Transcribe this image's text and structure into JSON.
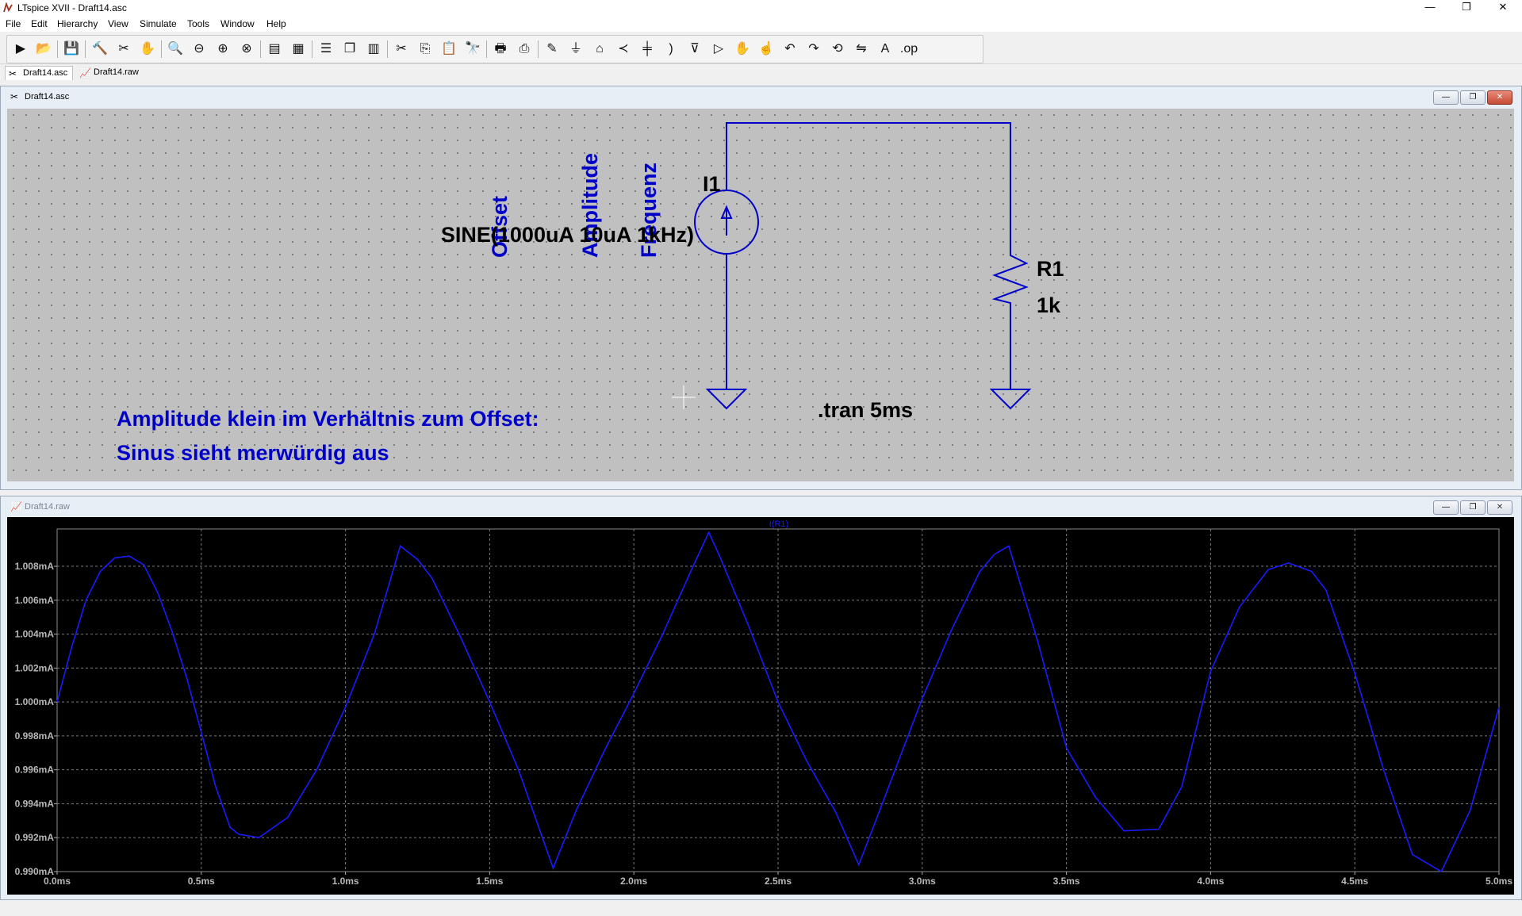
{
  "window": {
    "title": "LTspice XVII - Draft14.asc",
    "minimize_glyph": "—",
    "restore_glyph": "❐",
    "close_glyph": "✕"
  },
  "menu": [
    "File",
    "Edit",
    "Hierarchy",
    "View",
    "Simulate",
    "Tools",
    "Window",
    "Help"
  ],
  "toolbar_icons": [
    "run-icon",
    "open-icon",
    "save-icon",
    "control-panel-icon",
    "halt-icon",
    "pan-icon",
    "zoom-in-icon",
    "zoom-out-icon",
    "zoom-full-icon",
    "zoom-cancel-icon",
    "plot-settings-icon",
    "plot-add-icon",
    "tile-horizontal-icon",
    "cascade-icon",
    "tile-vertical-icon",
    "cut-icon",
    "copy-icon",
    "paste-icon",
    "find-icon",
    "print-icon",
    "print-setup-icon",
    "wire-icon",
    "ground-icon",
    "label-icon",
    "resistor-icon",
    "capacitor-icon",
    "inductor-icon",
    "diode-icon",
    "component-icon",
    "move-icon",
    "drag-icon",
    "undo-icon",
    "redo-icon",
    "rotate-icon",
    "mirror-icon",
    "text-icon",
    "spice-directive-icon"
  ],
  "tabs": [
    {
      "label": "Draft14.asc",
      "icon": "schematic-icon"
    },
    {
      "label": "Draft14.raw",
      "icon": "waveform-icon"
    }
  ],
  "schematic": {
    "window_title": "Draft14.asc",
    "labels": {
      "offset": "Offset",
      "amplitude": "Amplitude",
      "frequency": "Frequenz",
      "source_name": "I1",
      "source_value": "SINE(1000uA 10uA 1kHz)",
      "resistor_name": "R1",
      "resistor_value": "1k",
      "directive": ".tran 5ms",
      "comment_line1": "Amplitude klein im Verhältnis zum Offset:",
      "comment_line2": "Sinus sieht merwürdig aus"
    },
    "colors": {
      "wire": "#0000c8",
      "comment": "#0000c8",
      "text": "#000000",
      "canvas": "#c0c0c0"
    }
  },
  "waveform": {
    "window_title": "Draft14.raw",
    "trace_label": "I(R1)",
    "trace_color": "#1a1aff"
  },
  "chart_data": {
    "type": "line",
    "title": "",
    "xlabel": "",
    "ylabel": "",
    "xlim": [
      0,
      5
    ],
    "ylim": [
      0.99,
      1.0102
    ],
    "x_ticks": [
      "0.0ms",
      "0.5ms",
      "1.0ms",
      "1.5ms",
      "2.0ms",
      "2.5ms",
      "3.0ms",
      "3.5ms",
      "4.0ms",
      "4.5ms",
      "5.0ms"
    ],
    "y_ticks": [
      "0.990mA",
      "0.992mA",
      "0.994mA",
      "0.996mA",
      "0.998mA",
      "1.000mA",
      "1.002mA",
      "1.004mA",
      "1.006mA",
      "1.008mA"
    ],
    "grid": true,
    "series": [
      {
        "name": "I(R1)",
        "x": [
          0.0,
          0.05,
          0.1,
          0.15,
          0.2,
          0.25,
          0.3,
          0.35,
          0.4,
          0.45,
          0.5,
          0.55,
          0.6,
          0.63,
          0.7,
          0.8,
          0.9,
          1.0,
          1.1,
          1.19,
          1.25,
          1.3,
          1.4,
          1.5,
          1.6,
          1.72,
          1.8,
          1.9,
          2.0,
          2.1,
          2.2,
          2.26,
          2.3,
          2.4,
          2.5,
          2.6,
          2.7,
          2.78,
          2.85,
          3.0,
          3.1,
          3.2,
          3.25,
          3.3,
          3.4,
          3.5,
          3.6,
          3.7,
          3.82,
          3.9,
          4.0,
          4.1,
          4.2,
          4.27,
          4.35,
          4.4,
          4.5,
          4.6,
          4.65,
          4.7,
          4.8,
          4.9,
          5.0
        ],
        "y": [
          1.0,
          1.0032,
          1.006,
          1.0077,
          1.0085,
          1.0086,
          1.0081,
          1.0064,
          1.0041,
          1.0014,
          0.9982,
          0.995,
          0.9926,
          0.9922,
          0.992,
          0.9932,
          0.996,
          0.9997,
          1.004,
          1.0092,
          1.0084,
          1.0073,
          1.0038,
          1.0,
          0.996,
          0.9902,
          0.9936,
          0.9972,
          1.0005,
          1.004,
          1.0078,
          1.01,
          1.0085,
          1.0044,
          1.0,
          0.9965,
          0.9935,
          0.9904,
          0.9935,
          1.0002,
          1.0042,
          1.0077,
          1.0087,
          1.0092,
          1.0036,
          0.9973,
          0.9944,
          0.9924,
          0.9925,
          0.995,
          1.0018,
          1.0056,
          1.0078,
          1.0082,
          1.0077,
          1.0066,
          1.0017,
          0.996,
          0.9935,
          0.991,
          0.99,
          0.9936,
          0.9997
        ]
      }
    ]
  }
}
